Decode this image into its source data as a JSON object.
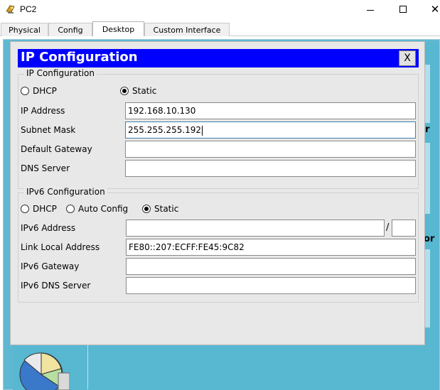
{
  "window": {
    "title": "PC2",
    "app_icon": "packet-tracer-pc-icon",
    "controls": [
      "minimize-icon",
      "maximize-icon",
      "close-icon"
    ]
  },
  "tabs": [
    {
      "label": "Physical",
      "active": false
    },
    {
      "label": "Config",
      "active": false
    },
    {
      "label": "Desktop",
      "active": true
    },
    {
      "label": "Custom Interface",
      "active": false
    }
  ],
  "background": {
    "partial_text_1": "r",
    "partial_text_2": "or"
  },
  "dialog": {
    "title": "IP Configuration",
    "close_label": "X",
    "ipv4": {
      "legend": "IP Configuration",
      "dhcp_label": "DHCP",
      "static_label": "Static",
      "mode": "Static",
      "ip_address_label": "IP Address",
      "ip_address_value": "192.168.10.130",
      "subnet_mask_label": "Subnet Mask",
      "subnet_mask_value": "255.255.255.192",
      "default_gateway_label": "Default Gateway",
      "default_gateway_value": "",
      "dns_server_label": "DNS Server",
      "dns_server_value": ""
    },
    "ipv6": {
      "legend": "IPv6 Configuration",
      "dhcp_label": "DHCP",
      "auto_config_label": "Auto Config",
      "static_label": "Static",
      "mode": "Static",
      "ipv6_address_label": "IPv6 Address",
      "ipv6_address_value": "",
      "prefix_separator": "/",
      "prefix_value": "",
      "link_local_label": "Link Local Address",
      "link_local_value": "FE80::207:ECFF:FE45:9C82",
      "ipv6_gateway_label": "IPv6 Gateway",
      "ipv6_gateway_value": "",
      "ipv6_dns_label": "IPv6 DNS Server",
      "ipv6_dns_value": ""
    }
  },
  "colors": {
    "dialog_header": "#0000ff",
    "desktop_bg": "#58b7d1",
    "dialog_bg": "#e8e8e8"
  }
}
